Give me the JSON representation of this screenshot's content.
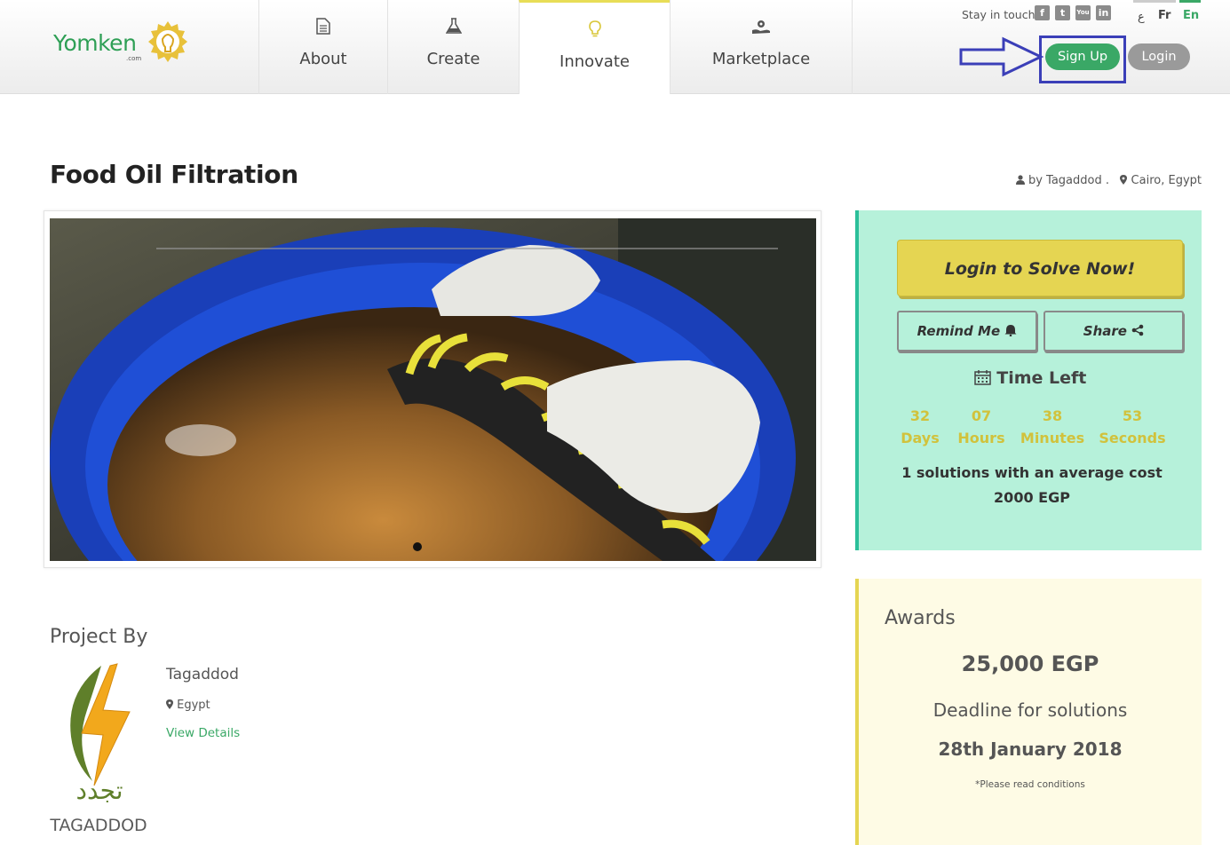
{
  "brand": {
    "logo_text": "Yomken",
    "logo_sub": ".com",
    "accent": "#3aa866",
    "yellow": "#e5d552"
  },
  "nav": [
    {
      "label": "About",
      "icon": "document-icon"
    },
    {
      "label": "Create",
      "icon": "flask-icon"
    },
    {
      "label": "Innovate",
      "icon": "lightbulb-icon",
      "active": true
    },
    {
      "label": "Marketplace",
      "icon": "hand-gear-icon"
    }
  ],
  "top": {
    "stay_in_touch": "Stay in touch",
    "social": [
      "facebook-icon",
      "twitter-icon",
      "youtube-icon",
      "linkedin-icon"
    ],
    "languages": [
      "ع",
      "Fr",
      "En"
    ],
    "active_language": "En",
    "signup": "Sign Up",
    "login": "Login"
  },
  "challenge": {
    "title": "Food Oil Filtration",
    "by": "by Tagaddod .",
    "location": "Cairo, Egypt"
  },
  "side": {
    "solve_button": "Login to Solve Now!",
    "remind_button": "Remind Me",
    "share_button": "Share",
    "time_left_label": "Time Left",
    "countdown": [
      {
        "value": "32",
        "label": "Days"
      },
      {
        "value": "07",
        "label": "Hours"
      },
      {
        "value": "38",
        "label": "Minutes"
      },
      {
        "value": "53",
        "label": "Seconds"
      }
    ],
    "solutions_text": "1 solutions with an average cost 2000 EGP"
  },
  "awards": {
    "title": "Awards",
    "amount": "25,000 EGP",
    "deadline_label": "Deadline for solutions",
    "deadline_date": "28th January  2018",
    "conditions": "*Please read conditions"
  },
  "project": {
    "heading": "Project By",
    "org_name": "Tagaddod",
    "org_country": "Egypt",
    "view_details": "View Details",
    "logo_wordmark": "TAGADDOD",
    "logo_arabic": "تجدد"
  }
}
